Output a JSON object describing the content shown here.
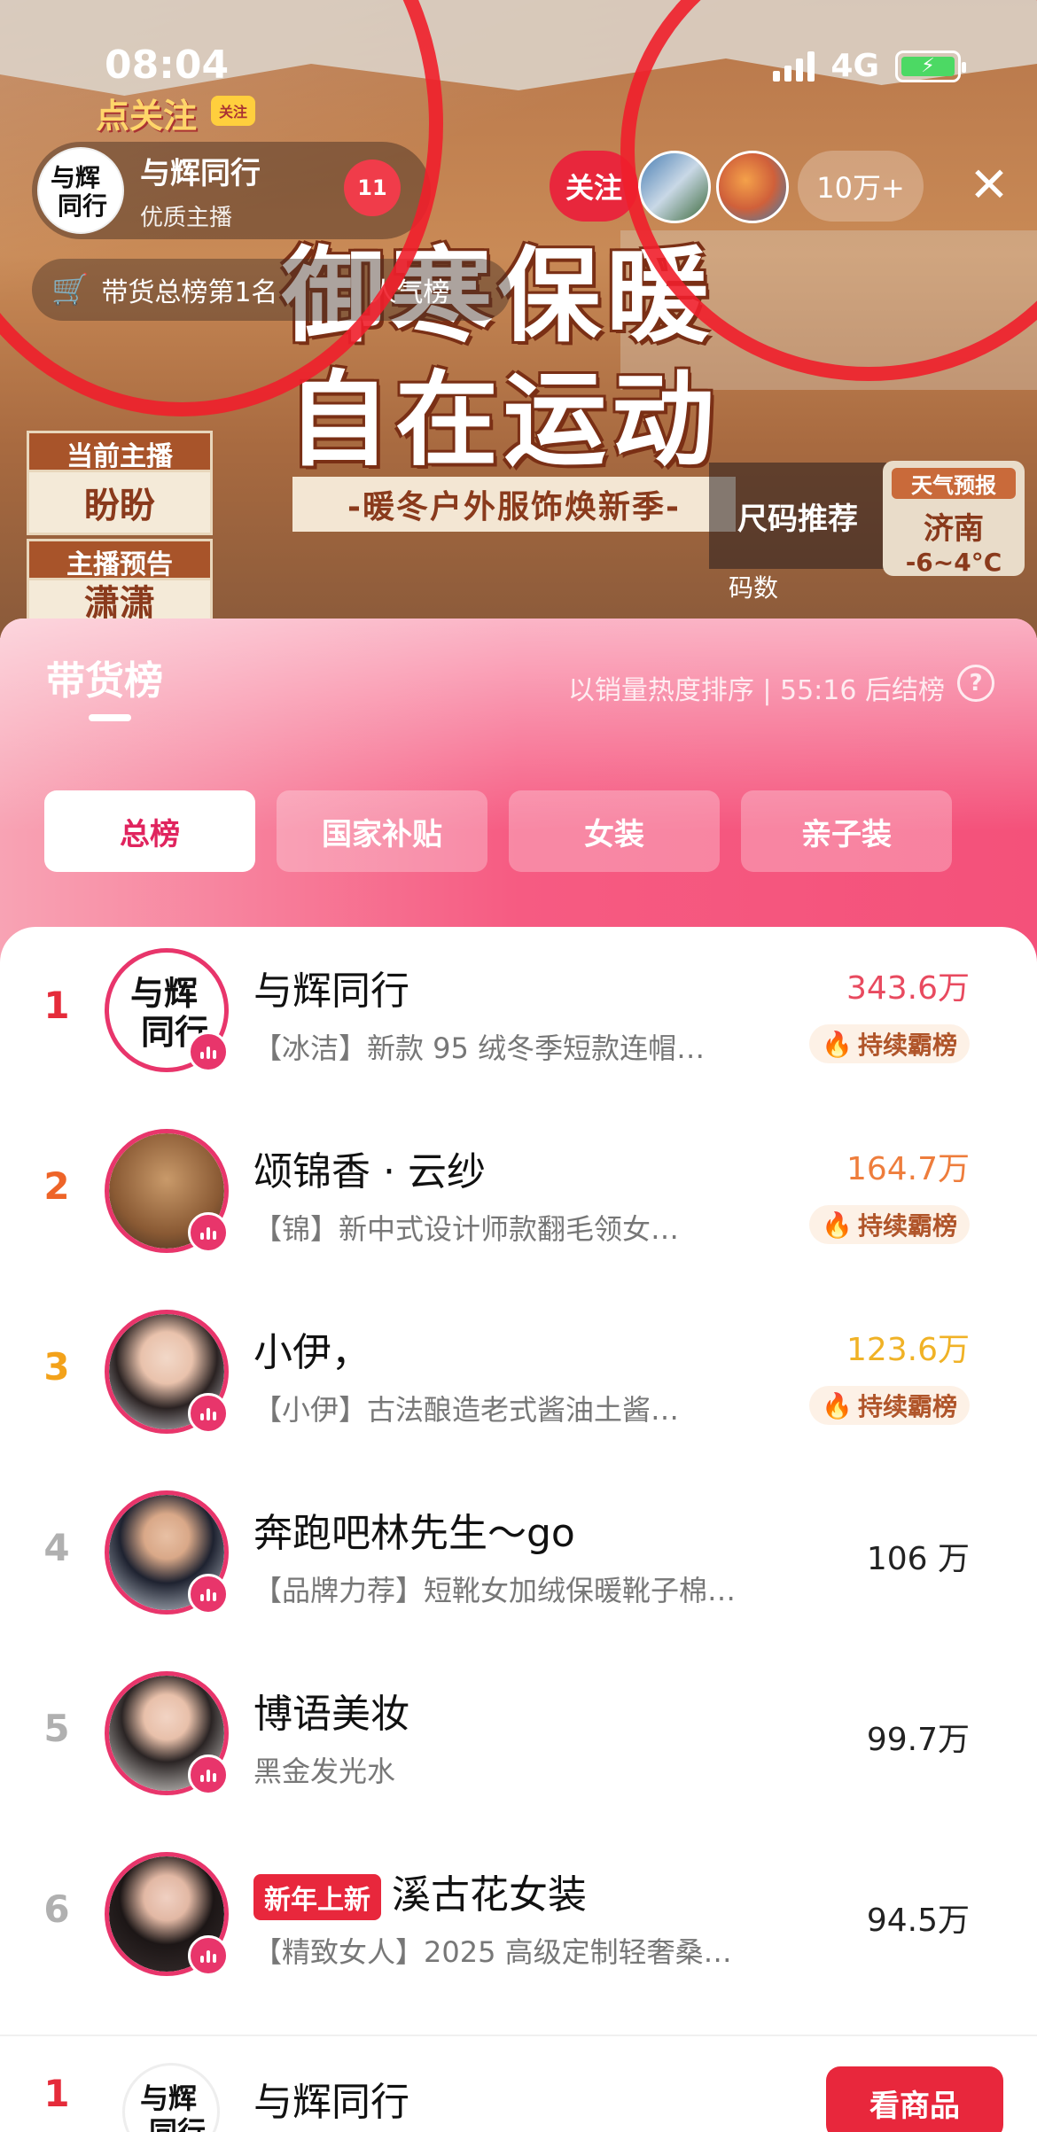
{
  "status_bar": {
    "time": "08:04",
    "network": "4G"
  },
  "stream": {
    "follow_tag": "点关注",
    "follow_mini": "关注",
    "anchor": {
      "name": "与辉同行",
      "subtitle": "优质主播",
      "avatar_text": "与辉\n同行"
    },
    "likes_count": "11",
    "follow_button": "关注",
    "viewer_count": "10万+",
    "close_icon": "close-icon",
    "rank_pill": {
      "text": "带货总榜第1名",
      "extra": "人气榜"
    },
    "banner": {
      "line1": "御寒保暖",
      "line2": "自在运动",
      "subtitle": "-暖冬户外服饰焕新季-"
    },
    "side_signs": [
      {
        "text": "当前主播"
      },
      {
        "text": "盼盼"
      },
      {
        "text": "主播预告"
      },
      {
        "text": "潇潇"
      }
    ],
    "weather": {
      "title": "天气预报",
      "city": "济南",
      "temp": "-6~4°C"
    },
    "size_promo": "尺码推荐",
    "size_label": "码数"
  },
  "panel": {
    "title": "带货榜",
    "note": "以销量热度排序 | 55:16 后结榜",
    "help_icon": "help-icon",
    "tabs": [
      {
        "label": "总榜",
        "active": true
      },
      {
        "label": "国家补贴",
        "active": false
      },
      {
        "label": "女装",
        "active": false
      },
      {
        "label": "亲子装",
        "active": false
      }
    ],
    "hold_badge_label": "持续霸榜",
    "rows": [
      {
        "rank": "1",
        "name": "与辉同行",
        "desc": "【冰洁】新款 95 绒冬季短款连帽…",
        "value": "343.6万",
        "badge": true
      },
      {
        "rank": "2",
        "name": "颂锦香 · 云纱",
        "desc": "【锦】新中式设计师款翻毛领女…",
        "value": "164.7万",
        "badge": true
      },
      {
        "rank": "3",
        "name": "小伊，",
        "desc": "【小伊】古法酿造老式酱油土酱…",
        "value": "123.6万",
        "badge": true
      },
      {
        "rank": "4",
        "name": "奔跑吧林先生～go",
        "desc": "【品牌力荐】短靴女加绒保暖靴子棉…",
        "value": "106 万",
        "badge": false
      },
      {
        "rank": "5",
        "name": "博语美妆",
        "desc": "黑金发光水",
        "value": "99.7万",
        "badge": false
      },
      {
        "rank": "6",
        "name": "溪古花女装",
        "tag": "新年上新",
        "desc": "【精致女人】2025 高级定制轻奢桑…",
        "value": "94.5万",
        "badge": false
      }
    ],
    "footer": {
      "rank": "1",
      "name": "与辉同行",
      "button": "看商品"
    }
  }
}
